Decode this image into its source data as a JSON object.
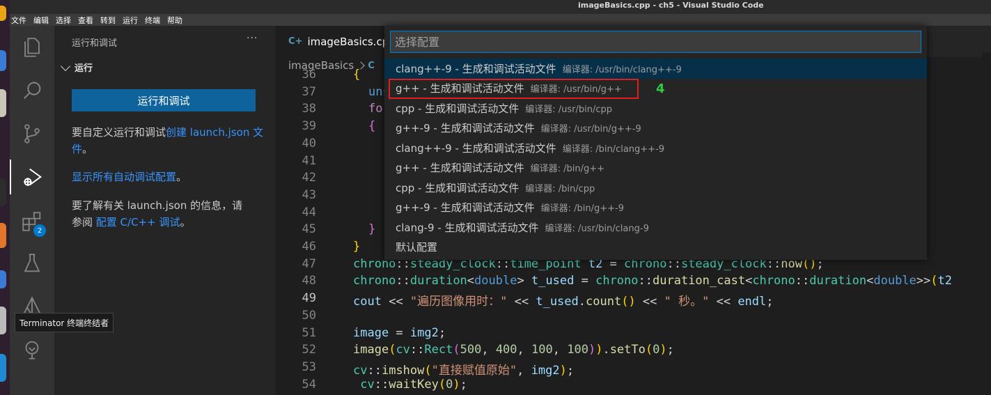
{
  "window": {
    "title": "imageBasics.cpp - ch5 - Visual Studio Code"
  },
  "menubar": [
    "文件",
    "编辑",
    "选择",
    "查看",
    "转到",
    "运行",
    "终端",
    "帮助"
  ],
  "activity_bar": {
    "items": [
      "explorer-icon",
      "search-icon",
      "source-control-icon",
      "run-debug-icon",
      "extensions-icon",
      "testing-icon",
      "cmake-icon",
      "remote-icon"
    ],
    "extensions_badge": "2"
  },
  "sidebar": {
    "title": "运行和调试",
    "more": "···",
    "section": "运行",
    "run_button": "运行和调试",
    "p1_prefix": "要自定义运行和调试",
    "p1_link": "创建 launch.json 文件",
    "p1_suffix": "。",
    "p2_link": "显示所有自动调试配置",
    "p2_suffix": "。",
    "p3_line1": "要了解有关 launch.json 的信息，请",
    "p3_prefix": "参阅 ",
    "p3_link": "配置 C/C++ 调试",
    "p3_suffix": "。"
  },
  "editor": {
    "tab_label": "imageBasics.cpp",
    "breadcrumb": [
      "imageBasics",
      "C"
    ],
    "current_line": "49"
  },
  "code_lines": [
    {
      "n": "36",
      "s": "{"
    },
    {
      "n": "37",
      "s": "uns"
    },
    {
      "n": "38",
      "s": "fo"
    },
    {
      "n": "39",
      "s": "{"
    },
    {
      "n": "40",
      "s": ""
    },
    {
      "n": "41",
      "s": ""
    },
    {
      "n": "42",
      "s": ""
    },
    {
      "n": "43",
      "s": ""
    },
    {
      "n": "44",
      "s": ""
    },
    {
      "n": "45",
      "s": "}"
    },
    {
      "n": "46",
      "s": "}"
    },
    {
      "n": "47",
      "s": "chrono::steady_clock::time_point t2 = chrono::steady_clock::now();"
    },
    {
      "n": "48",
      "s": "chrono::duration<double> t_used = chrono::duration_cast<chrono::duration<double>>(t2"
    },
    {
      "n": "49",
      "s": "cout << \"遍历图像用时：\" << t_used.count() << \" 秒。\" << endl;"
    },
    {
      "n": "50",
      "s": ""
    },
    {
      "n": "51",
      "s": "image = img2;"
    },
    {
      "n": "52",
      "s": "image(cv::Rect(500, 400, 100, 100)).setTo(0);"
    },
    {
      "n": "53",
      "s": "cv::imshow(\"直接赋值原始\", img2);"
    },
    {
      "n": "54",
      "s": " cv::waitKey(0);"
    }
  ],
  "quick_pick": {
    "placeholder": "选择配置",
    "items": [
      {
        "label": "clang++-9 - 生成和调试活动文件",
        "desc": "编译器: /usr/bin/clang++-9",
        "selected": true
      },
      {
        "label": "g++ - 生成和调试活动文件",
        "desc": "编译器: /usr/bin/g++",
        "highlighted": true
      },
      {
        "label": "cpp - 生成和调试活动文件",
        "desc": "编译器: /usr/bin/cpp"
      },
      {
        "label": "g++-9 - 生成和调试活动文件",
        "desc": "编译器: /usr/bin/g++-9"
      },
      {
        "label": "clang++-9 - 生成和调试活动文件",
        "desc": "编译器: /bin/clang++-9"
      },
      {
        "label": "g++ - 生成和调试活动文件",
        "desc": "编译器: /bin/g++"
      },
      {
        "label": "cpp - 生成和调试活动文件",
        "desc": "编译器: /bin/cpp"
      },
      {
        "label": "g++-9 - 生成和调试活动文件",
        "desc": "编译器: /bin/g++-9"
      },
      {
        "label": "clang-9 - 生成和调试活动文件",
        "desc": "编译器: /usr/bin/clang-9"
      },
      {
        "label": "默认配置",
        "desc": ""
      }
    ]
  },
  "annotation": {
    "step_number": "4",
    "color": "#e0201e"
  },
  "tooltip": "Terminator 终端终结者",
  "colors": {
    "accent": "#007acc",
    "link": "#3794ff",
    "button": "#0e639c",
    "highlight_box": "#e0201e",
    "step": "#2ecc40"
  }
}
